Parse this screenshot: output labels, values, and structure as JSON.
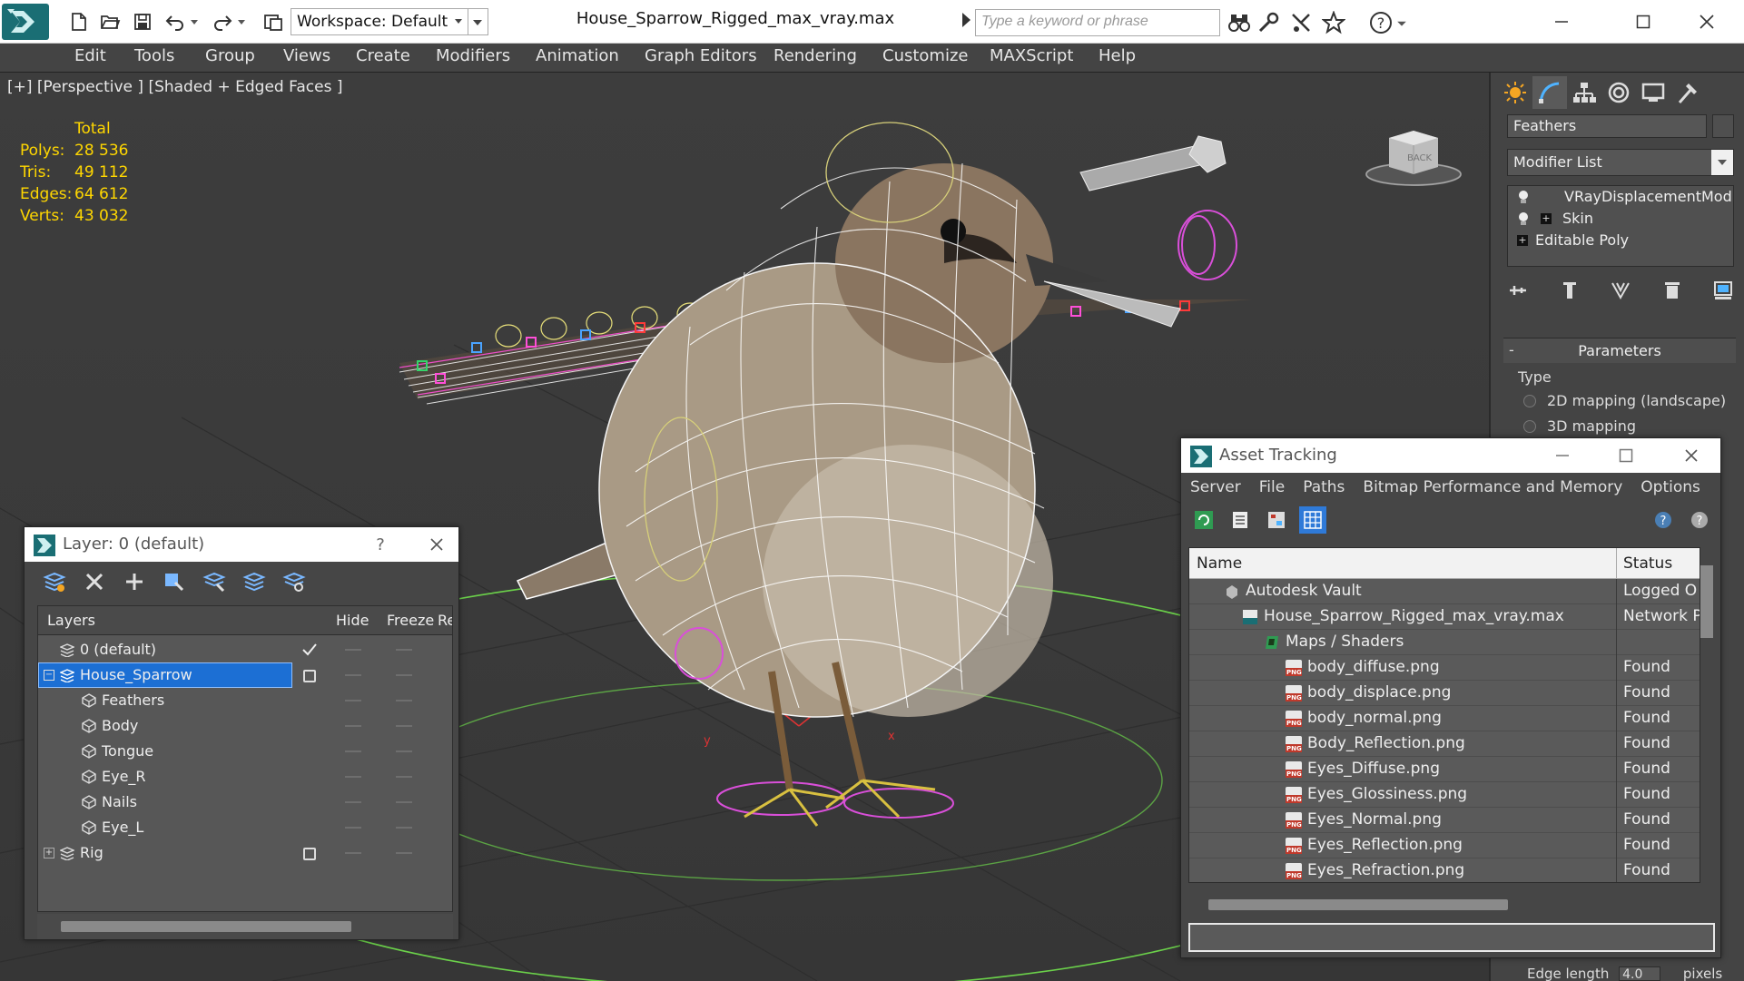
{
  "titlebar": {
    "workspace": "Workspace: Default",
    "file_title": "House_Sparrow_Rigged_max_vray.max",
    "search_placeholder": "Type a keyword or phrase"
  },
  "menu": [
    "Edit",
    "Tools",
    "Group",
    "Views",
    "Create",
    "Modifiers",
    "Animation",
    "Graph Editors",
    "Rendering",
    "Customize",
    "MAXScript",
    "Help"
  ],
  "viewport": {
    "label": "[+] [Perspective ] [Shaded + Edged Faces ]",
    "stats": {
      "header": "Total",
      "rows": [
        {
          "label": "Polys:",
          "value": "28 536"
        },
        {
          "label": "Tris:",
          "value": "49 112"
        },
        {
          "label": "Edges:",
          "value": "64 612"
        },
        {
          "label": "Verts:",
          "value": "43 032"
        }
      ]
    },
    "viewcube_label": "BACK",
    "axis_x": "x",
    "axis_y": "y"
  },
  "command_panel": {
    "object_name": "Feathers",
    "modifier_list": "Modifier List",
    "stack": [
      "VRayDisplacementMod",
      "Skin",
      "Editable Poly"
    ],
    "rollout_title": "Parameters",
    "rollout_minus": "-",
    "type_label": "Type",
    "radio_options": [
      "2D mapping (landscape)",
      "3D mapping"
    ],
    "edge_length_label": "Edge length",
    "edge_length_value": "4.0",
    "edge_length_unit": "pixels"
  },
  "layer_panel": {
    "title": "Layer: 0 (default)",
    "help": "?",
    "columns": [
      "Layers",
      "Hide",
      "Freeze",
      "Re"
    ],
    "rows": [
      {
        "name": "0 (default)",
        "indent": 1,
        "type": "layer"
      },
      {
        "name": "House_Sparrow",
        "indent": 1,
        "type": "layer"
      },
      {
        "name": "Feathers",
        "indent": 2,
        "type": "object"
      },
      {
        "name": "Body",
        "indent": 2,
        "type": "object"
      },
      {
        "name": "Tongue",
        "indent": 2,
        "type": "object"
      },
      {
        "name": "Eye_R",
        "indent": 2,
        "type": "object"
      },
      {
        "name": "Nails",
        "indent": 2,
        "type": "object"
      },
      {
        "name": "Eye_L",
        "indent": 2,
        "type": "object"
      },
      {
        "name": "Rig",
        "indent": 1,
        "type": "layer"
      }
    ]
  },
  "asset_panel": {
    "title": "Asset Tracking",
    "menu": [
      "Server",
      "File",
      "Paths",
      "Bitmap Performance and Memory",
      "Options"
    ],
    "columns": [
      "Name",
      "Status"
    ],
    "rows": [
      {
        "name": "Autodesk Vault",
        "status": "Logged O",
        "indent": 1,
        "icon": "vault"
      },
      {
        "name": "House_Sparrow_Rigged_max_vray.max",
        "status": "Network P",
        "indent": 2,
        "icon": "max"
      },
      {
        "name": "Maps / Shaders",
        "status": "",
        "indent": 3,
        "icon": "maps"
      },
      {
        "name": "body_diffuse.png",
        "status": "Found",
        "indent": 4,
        "icon": "png"
      },
      {
        "name": "body_displace.png",
        "status": "Found",
        "indent": 4,
        "icon": "png"
      },
      {
        "name": "body_normal.png",
        "status": "Found",
        "indent": 4,
        "icon": "png"
      },
      {
        "name": "Body_Reflection.png",
        "status": "Found",
        "indent": 4,
        "icon": "png"
      },
      {
        "name": "Eyes_Diffuse.png",
        "status": "Found",
        "indent": 4,
        "icon": "png"
      },
      {
        "name": "Eyes_Glossiness.png",
        "status": "Found",
        "indent": 4,
        "icon": "png"
      },
      {
        "name": "Eyes_Normal.png",
        "status": "Found",
        "indent": 4,
        "icon": "png"
      },
      {
        "name": "Eyes_Reflection.png",
        "status": "Found",
        "indent": 4,
        "icon": "png"
      },
      {
        "name": "Eyes_Refraction.png",
        "status": "Found",
        "indent": 4,
        "icon": "png"
      }
    ]
  },
  "colors": {
    "stats_text": "#ffd700",
    "selection": "#1c6fd4",
    "viewport_bg": "#3a3a3a",
    "brand": "#1a6e74"
  }
}
